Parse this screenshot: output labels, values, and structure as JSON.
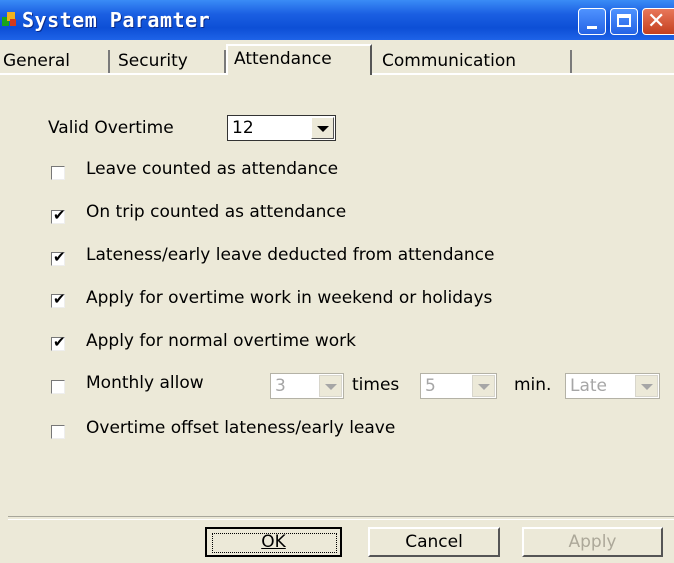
{
  "window": {
    "title": "System Paramter"
  },
  "tabs": [
    {
      "label": "General"
    },
    {
      "label": "Security"
    },
    {
      "label": "Attendance"
    },
    {
      "label": "Communication"
    }
  ],
  "attendance": {
    "valid_overtime_label": "Valid Overtime",
    "valid_overtime_value": "12",
    "options": [
      {
        "label": "Leave counted as attendance",
        "checked": false
      },
      {
        "label": "On trip counted as attendance",
        "checked": true
      },
      {
        "label": "Lateness/early leave deducted from attendance",
        "checked": true
      },
      {
        "label": "Apply for overtime work in weekend or holidays",
        "checked": true
      },
      {
        "label": "Apply for normal overtime work",
        "checked": true
      },
      {
        "label": "Monthly allow",
        "checked": false
      },
      {
        "label": "Overtime offset lateness/early leave",
        "checked": false
      }
    ],
    "monthly_times_value": "3",
    "times_label": "times",
    "monthly_min_value": "5",
    "min_label": "min.",
    "late_value": "Late"
  },
  "buttons": {
    "ok": "OK",
    "cancel": "Cancel",
    "apply": "Apply"
  },
  "check_glyph": "✔"
}
